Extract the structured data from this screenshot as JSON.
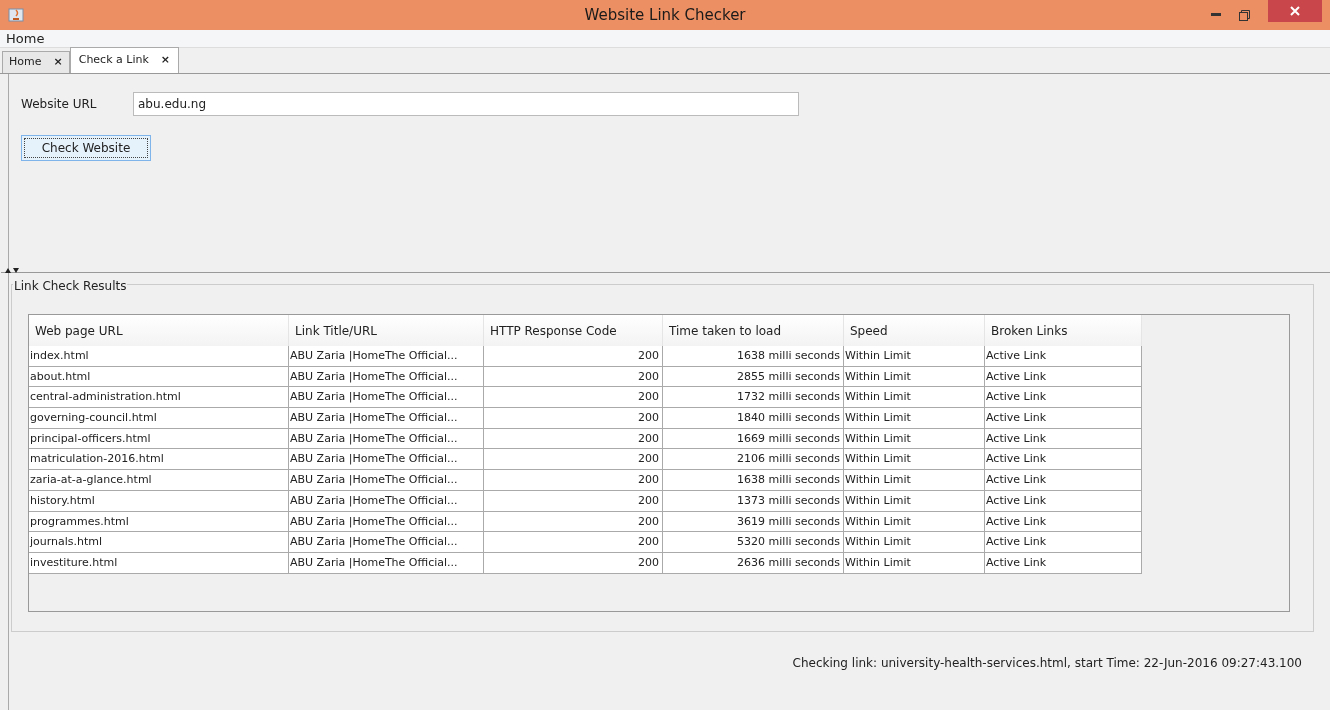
{
  "window": {
    "title": "Website Link Checker"
  },
  "menu": [
    "Home"
  ],
  "tabs": [
    {
      "label": "Home",
      "close": "×",
      "selected": false
    },
    {
      "label": "Check a Link",
      "close": "×",
      "selected": true
    }
  ],
  "form": {
    "url_label": "Website URL",
    "url_value": "abu.edu.ng",
    "button": "Check Website"
  },
  "results": {
    "title": "Link Check Results",
    "columns": [
      {
        "label": "Web page URL",
        "kind": "text"
      },
      {
        "label": "Link Title/URL",
        "kind": "text"
      },
      {
        "label": "HTTP Response Code",
        "kind": "number"
      },
      {
        "label": "Time taken to load",
        "kind": "number"
      },
      {
        "label": "Speed",
        "kind": "text"
      },
      {
        "label": "Broken Links",
        "kind": "text"
      }
    ],
    "rows": [
      [
        "index.html",
        "ABU Zaria |HomeThe Official...",
        "200",
        "1638 milli seconds",
        "Within Limit",
        "Active Link"
      ],
      [
        "about.html",
        "ABU Zaria |HomeThe Official...",
        "200",
        "2855 milli seconds",
        "Within Limit",
        "Active Link"
      ],
      [
        "central-administration.html",
        "ABU Zaria |HomeThe Official...",
        "200",
        "1732 milli seconds",
        "Within Limit",
        "Active Link"
      ],
      [
        "governing-council.html",
        "ABU Zaria |HomeThe Official...",
        "200",
        "1840 milli seconds",
        "Within Limit",
        "Active Link"
      ],
      [
        "principal-officers.html",
        "ABU Zaria |HomeThe Official...",
        "200",
        "1669 milli seconds",
        "Within Limit",
        "Active Link"
      ],
      [
        "matriculation-2016.html",
        "ABU Zaria |HomeThe Official...",
        "200",
        "2106 milli seconds",
        "Within Limit",
        "Active Link"
      ],
      [
        "zaria-at-a-glance.html",
        "ABU Zaria |HomeThe Official...",
        "200",
        "1638 milli seconds",
        "Within Limit",
        "Active Link"
      ],
      [
        "history.html",
        "ABU Zaria |HomeThe Official...",
        "200",
        "1373 milli seconds",
        "Within Limit",
        "Active Link"
      ],
      [
        "programmes.html",
        "ABU Zaria |HomeThe Official...",
        "200",
        "3619 milli seconds",
        "Within Limit",
        "Active Link"
      ],
      [
        "journals.html",
        "ABU Zaria |HomeThe Official...",
        "200",
        "5320 milli seconds",
        "Within Limit",
        "Active Link"
      ],
      [
        "investiture.html",
        "ABU Zaria |HomeThe Official...",
        "200",
        "2636 milli seconds",
        "Within Limit",
        "Active Link"
      ]
    ]
  },
  "status_bar": "Checking link: university-health-services.html, start Time: 22-Jun-2016 09:27:43.100"
}
